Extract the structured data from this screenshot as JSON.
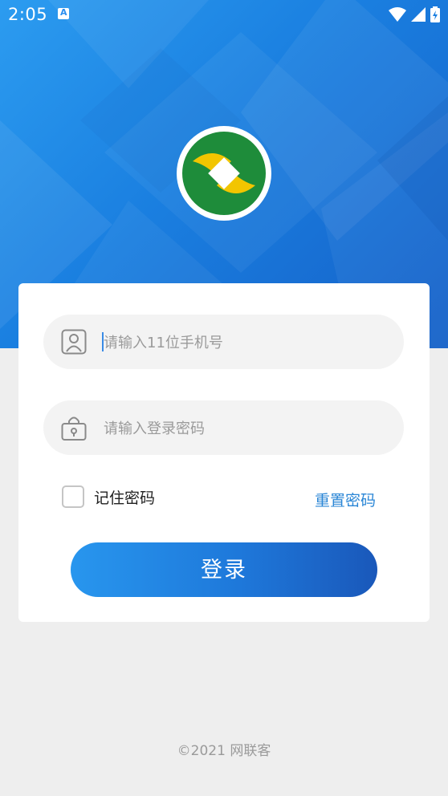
{
  "status_bar": {
    "time": "2:05",
    "icons": [
      "notification-a-icon",
      "wifi-icon",
      "signal-icon",
      "battery-icon"
    ]
  },
  "brand": {
    "logo": "ring-logo",
    "colors": {
      "green": "#1e8c3a",
      "gold": "#f2c500",
      "hero_blue": "#1a7fe0"
    }
  },
  "login": {
    "phone_placeholder": "请输入11位手机号",
    "password_placeholder": "请输入登录密码",
    "remember_label": "记住密码",
    "remember_checked": false,
    "reset_label": "重置密码",
    "submit_label": "登录"
  },
  "footer": {
    "copyright": "©2021 网联客"
  }
}
